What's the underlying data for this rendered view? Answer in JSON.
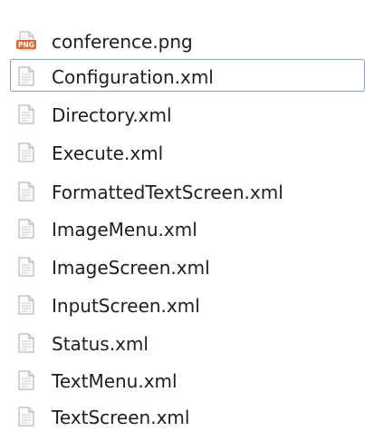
{
  "files": [
    {
      "name": "conference.png",
      "icon": "png-file-icon",
      "icon_label": "PNG",
      "selected": false
    },
    {
      "name": "Configuration.xml",
      "icon": "xml-file-icon",
      "selected": true
    },
    {
      "name": "Directory.xml",
      "icon": "xml-file-icon",
      "selected": false
    },
    {
      "name": "Execute.xml",
      "icon": "xml-file-icon",
      "selected": false
    },
    {
      "name": "FormattedTextScreen.xml",
      "icon": "xml-file-icon",
      "selected": false
    },
    {
      "name": "ImageMenu.xml",
      "icon": "xml-file-icon",
      "selected": false
    },
    {
      "name": "ImageScreen.xml",
      "icon": "xml-file-icon",
      "selected": false
    },
    {
      "name": "InputScreen.xml",
      "icon": "xml-file-icon",
      "selected": false
    },
    {
      "name": "Status.xml",
      "icon": "xml-file-icon",
      "selected": false
    },
    {
      "name": "TextMenu.xml",
      "icon": "xml-file-icon",
      "selected": false
    },
    {
      "name": "TextScreen.xml",
      "icon": "xml-file-icon",
      "selected": false
    }
  ],
  "colors": {
    "selection_border": "#7da2ce",
    "text": "#1e1e1e",
    "png_badge": "#e8632b"
  }
}
